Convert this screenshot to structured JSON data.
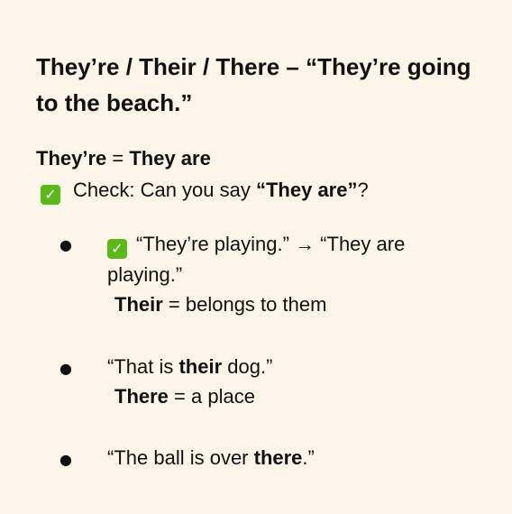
{
  "title": "They’re / Their / There – “They’re going to the beach.”",
  "theyre_def": {
    "term": "They’re",
    "rest": " = ",
    "meaning": "They are"
  },
  "check": {
    "icon": "check-mark-button-icon",
    "text": "Check: Can you say ",
    "bold": "“They are”",
    "end": "?"
  },
  "bullet_char": "●",
  "item1": {
    "icon": "check-mark-button-icon",
    "text": "“They’re playing.” → “They are playing.”"
  },
  "their_def": {
    "term": "Their",
    "rest": " = belongs to them"
  },
  "item2": {
    "before": "“That is ",
    "bold": "their",
    "after": " dog.”"
  },
  "there_def": {
    "term": "There",
    "rest": " = a place"
  },
  "item3": {
    "before": "“The ball is over ",
    "bold": "there",
    "after": ".”"
  },
  "colors": {
    "background": "#fcf5e8",
    "text": "#111111",
    "check_icon": "#5cb81c"
  }
}
